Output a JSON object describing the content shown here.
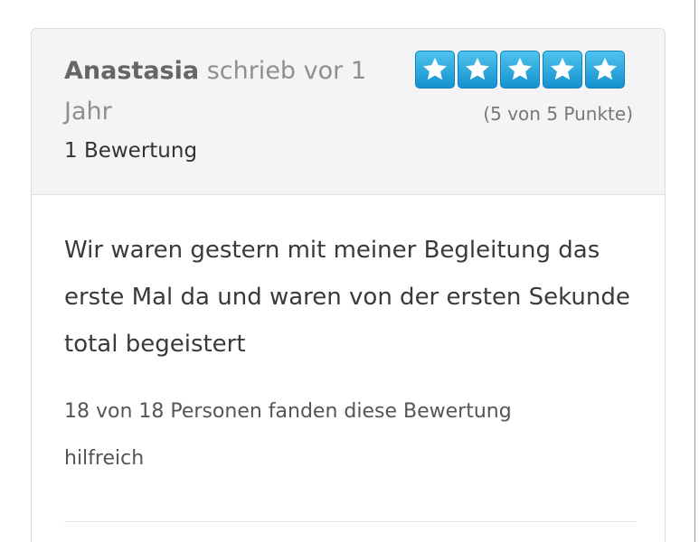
{
  "review": {
    "author": "Anastasia",
    "time_text": "schrieb vor 1 Jahr",
    "review_count_text": "1 Bewertung",
    "rating": {
      "value": 5,
      "max": 5,
      "text": "(5 von 5 Punkte)",
      "star_color": "#1591cf"
    },
    "body": "Wir waren gestern mit meiner Begleitung das erste Mal da und waren von der ersten Sekunde total begeistert",
    "helpful_text": "18 von 18 Personen fanden diese Bewertung hilfreich"
  }
}
